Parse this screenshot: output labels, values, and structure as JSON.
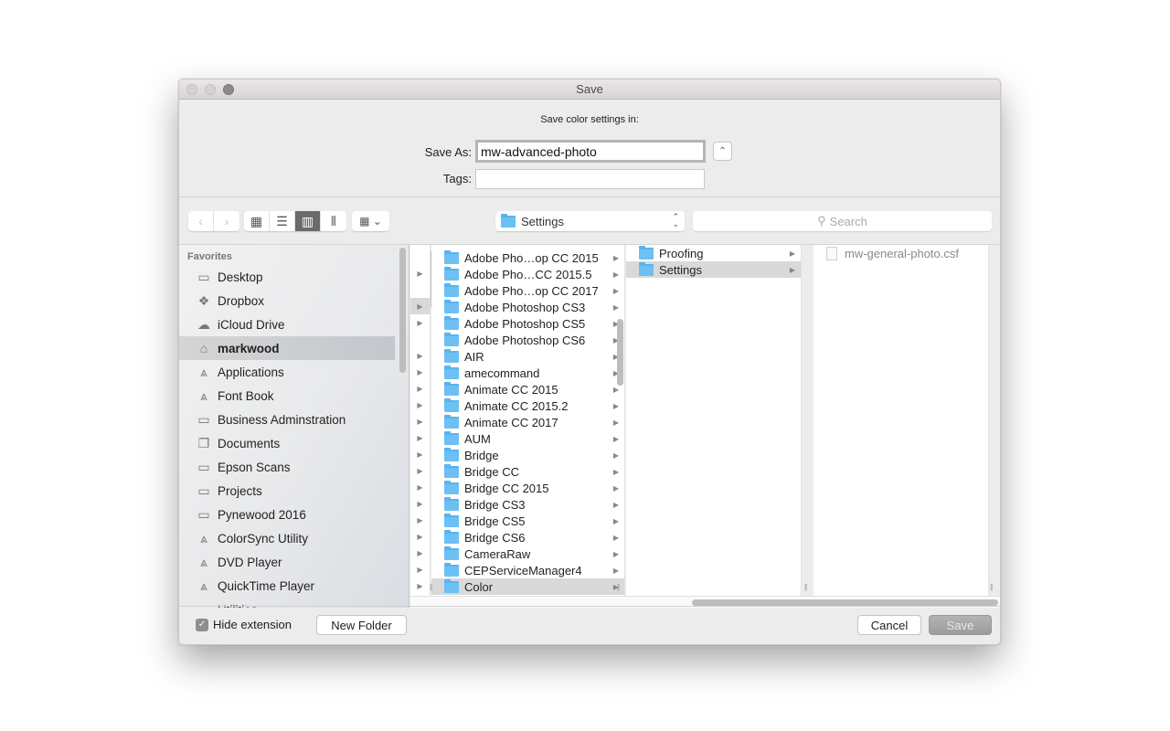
{
  "window": {
    "title": "Save"
  },
  "header": {
    "prompt": "Save color settings in:",
    "save_as_label": "Save As:",
    "save_as_value": "mw-advanced-photo",
    "tags_label": "Tags:",
    "tags_value": ""
  },
  "toolbar": {
    "back_icon": "chevron-left",
    "forward_icon": "chevron-right",
    "views": [
      {
        "name": "icon-view",
        "glyph": "▦",
        "selected": false
      },
      {
        "name": "list-view",
        "glyph": "☰",
        "selected": false
      },
      {
        "name": "column-view",
        "glyph": "▥",
        "selected": true
      },
      {
        "name": "coverflow-view",
        "glyph": "⫴",
        "selected": false
      }
    ],
    "arrange_glyph": "▦ ⌄",
    "location": "Settings",
    "search_placeholder": "Search"
  },
  "sidebar": {
    "heading": "Favorites",
    "items": [
      {
        "label": "Desktop",
        "icon": "desktop-icon",
        "glyph": "▭",
        "selected": false
      },
      {
        "label": "Dropbox",
        "icon": "dropbox-icon",
        "glyph": "❖",
        "selected": false
      },
      {
        "label": "iCloud Drive",
        "icon": "cloud-icon",
        "glyph": "☁",
        "selected": false
      },
      {
        "label": "markwood",
        "icon": "home-icon",
        "glyph": "⌂",
        "selected": true
      },
      {
        "label": "Applications",
        "icon": "applications-icon",
        "glyph": "⩓",
        "selected": false
      },
      {
        "label": "Font Book",
        "icon": "applications-icon",
        "glyph": "⩓",
        "selected": false
      },
      {
        "label": "Business Adminstration",
        "icon": "folder-icon",
        "glyph": "▭",
        "selected": false
      },
      {
        "label": "Documents",
        "icon": "documents-icon",
        "glyph": "❐",
        "selected": false
      },
      {
        "label": "Epson Scans",
        "icon": "folder-icon",
        "glyph": "▭",
        "selected": false
      },
      {
        "label": "Projects",
        "icon": "folder-icon",
        "glyph": "▭",
        "selected": false
      },
      {
        "label": "Pynewood 2016",
        "icon": "folder-icon",
        "glyph": "▭",
        "selected": false
      },
      {
        "label": "ColorSync Utility",
        "icon": "applications-icon",
        "glyph": "⩓",
        "selected": false
      },
      {
        "label": "DVD Player",
        "icon": "applications-icon",
        "glyph": "⩓",
        "selected": false
      },
      {
        "label": "QuickTime Player",
        "icon": "applications-icon",
        "glyph": "⩓",
        "selected": false
      },
      {
        "label": "Utilities",
        "icon": "folder-icon",
        "glyph": "▭",
        "selected": false
      }
    ]
  },
  "columns": {
    "col1_arrows": [
      false,
      true,
      false,
      true,
      true,
      false,
      true,
      true,
      true,
      true,
      true,
      true,
      true,
      true,
      true,
      true,
      true,
      true,
      true,
      true,
      true,
      true
    ],
    "col1_selected_index": 3,
    "col2": [
      {
        "label": "Adobe Pho…op CC 2015",
        "selected": false
      },
      {
        "label": "Adobe Pho…CC 2015.5",
        "selected": false
      },
      {
        "label": "Adobe Pho…op CC 2017",
        "selected": false
      },
      {
        "label": "Adobe Photoshop CS3",
        "selected": false
      },
      {
        "label": "Adobe Photoshop CS5",
        "selected": false
      },
      {
        "label": "Adobe Photoshop CS6",
        "selected": false
      },
      {
        "label": "AIR",
        "selected": false
      },
      {
        "label": "amecommand",
        "selected": false
      },
      {
        "label": "Animate CC 2015",
        "selected": false
      },
      {
        "label": "Animate CC 2015.2",
        "selected": false
      },
      {
        "label": "Animate CC 2017",
        "selected": false
      },
      {
        "label": "AUM",
        "selected": false
      },
      {
        "label": "Bridge",
        "selected": false
      },
      {
        "label": "Bridge CC",
        "selected": false
      },
      {
        "label": "Bridge CC 2015",
        "selected": false
      },
      {
        "label": "Bridge CS3",
        "selected": false
      },
      {
        "label": "Bridge CS5",
        "selected": false
      },
      {
        "label": "Bridge CS6",
        "selected": false
      },
      {
        "label": "CameraRaw",
        "selected": false
      },
      {
        "label": "CEPServiceManager4",
        "selected": false
      },
      {
        "label": "Color",
        "selected": true
      }
    ],
    "col3": [
      {
        "label": "Proofing",
        "selected": false
      },
      {
        "label": "Settings",
        "selected": true
      }
    ],
    "col4": [
      {
        "label": "mw-general-photo.csf"
      }
    ]
  },
  "footer": {
    "hide_extension_label": "Hide extension",
    "hide_extension_checked": true,
    "new_folder_label": "New Folder",
    "cancel_label": "Cancel",
    "save_label": "Save"
  }
}
